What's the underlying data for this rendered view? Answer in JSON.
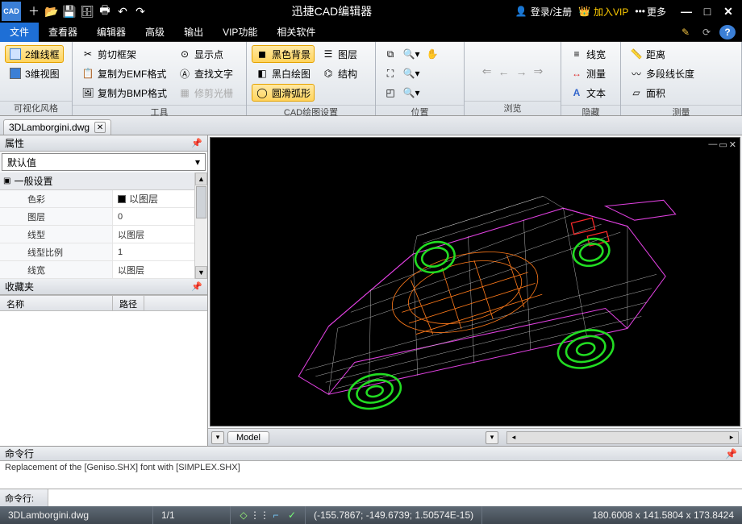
{
  "titlebar": {
    "app_icon_text": "CAD",
    "title": "迅捷CAD编辑器",
    "login": "登录/注册",
    "vip": "加入VIP",
    "more": "更多"
  },
  "menubar": {
    "tabs": [
      "文件",
      "查看器",
      "编辑器",
      "高级",
      "输出",
      "VIP功能",
      "相关软件"
    ],
    "active_index": 0
  },
  "ribbon": {
    "groups": {
      "g0": {
        "label": "可视化风格",
        "btn0": "2维线框",
        "btn1": "3维视图"
      },
      "g1": {
        "label": "工具",
        "btn0": "剪切框架",
        "btn1": "复制为EMF格式",
        "btn2": "复制为BMP格式",
        "btn3": "显示点",
        "btn4": "查找文字",
        "btn5": "修剪光栅"
      },
      "g2": {
        "label": "CAD绘图设置",
        "btn0": "黑色背景",
        "btn1": "黑白绘图",
        "btn2": "圆滑弧形",
        "btn3": "图层",
        "btn4": "结构"
      },
      "g3": {
        "label": "位置"
      },
      "g4": {
        "label": "浏览"
      },
      "g5": {
        "label": "隐藏",
        "btn0": "线宽",
        "btn1": "测量",
        "btn2": "文本"
      },
      "g6": {
        "label": "测量",
        "btn0": "距离",
        "btn1": "多段线长度",
        "btn2": "面积"
      }
    }
  },
  "doctab": {
    "name": "3DLamborgini.dwg"
  },
  "props": {
    "panel_title": "属性",
    "default": "默认值",
    "section0": "一般设置",
    "rows": {
      "r0k": "色彩",
      "r0v": "以图层",
      "r1k": "图层",
      "r1v": "0",
      "r2k": "线型",
      "r2v": "以图层",
      "r3k": "线型比例",
      "r3v": "1",
      "r4k": "线宽",
      "r4v": "以图层"
    }
  },
  "fav": {
    "title": "收藏夹",
    "col0": "名称",
    "col1": "路径"
  },
  "viewtabs": {
    "model": "Model"
  },
  "cmd": {
    "title": "命令行",
    "log": "Replacement of the [Geniso.SHX] font with [SIMPLEX.SHX]",
    "prompt": "命令行:"
  },
  "status": {
    "file": "3DLamborgini.dwg",
    "page": "1/1",
    "coords": "(-155.7867; -149.6739; 1.50574E-15)",
    "dims": "180.6008 x 141.5804 x 173.8424"
  }
}
